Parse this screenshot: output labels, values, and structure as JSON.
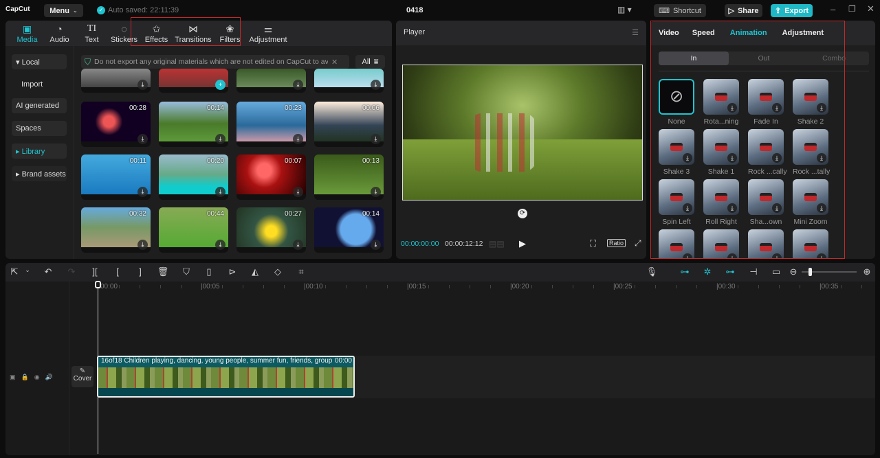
{
  "app": {
    "logo": "CapCut",
    "menu_label": "Menu",
    "autosave": "Auto saved: 22:11:39",
    "project_title": "0418",
    "shortcut_label": "Shortcut",
    "share_label": "Share",
    "export_label": "Export"
  },
  "colors": {
    "accent": "#1fc4d0",
    "highlight_box": "#c62828"
  },
  "media_tabs": [
    {
      "label": "Media",
      "icon": "media-icon"
    },
    {
      "label": "Audio",
      "icon": "audio-icon"
    },
    {
      "label": "Text",
      "icon": "text-icon"
    },
    {
      "label": "Stickers",
      "icon": "stickers-icon"
    },
    {
      "label": "Effects",
      "icon": "effects-icon"
    },
    {
      "label": "Transitions",
      "icon": "transitions-icon"
    },
    {
      "label": "Filters",
      "icon": "filters-icon"
    },
    {
      "label": "Adjustment",
      "icon": "adjustment-icon"
    }
  ],
  "sidebar": {
    "items": [
      {
        "label": "▾ Local"
      },
      {
        "label": "Import"
      },
      {
        "label": "AI generated"
      },
      {
        "label": "Spaces"
      },
      {
        "label": "▸ Library"
      },
      {
        "label": "▸ Brand assets"
      }
    ]
  },
  "notice": {
    "text": "Do not export any original materials which are not edited on CapCut to avoid",
    "filter_label": "All"
  },
  "library": {
    "durations": [
      "",
      "",
      "",
      "",
      "00:28",
      "00:14",
      "00:23",
      "00:06",
      "00:11",
      "00:20",
      "00:07",
      "00:13",
      "00:32",
      "00:44",
      "00:27",
      "00:14"
    ]
  },
  "player": {
    "title": "Player",
    "current_time": "00:00:00:00",
    "total_time": "00:00:12:12",
    "ratio_label": "Ratio"
  },
  "inspector": {
    "tabs": [
      "Video",
      "Speed",
      "Animation",
      "Adjustment"
    ],
    "active_tab": "Animation",
    "subtabs": [
      "In",
      "Out",
      "Combo"
    ],
    "animations": [
      "None",
      "Rota...ning",
      "Fade In",
      "Shake 2",
      "Shake 3",
      "Shake 1",
      "Rock ...cally",
      "Rock ...tally",
      "Spin Left",
      "Roll Right",
      "Sha...own",
      "Mini Zoom",
      "",
      "",
      "",
      ""
    ]
  },
  "timeline": {
    "ticks": [
      "00:00",
      "|00:05",
      "|00:10",
      "|00:15",
      "|00:20",
      "|00:25",
      "|00:30",
      "|00:35"
    ],
    "clip_title": "16of18 Children playing, dancing, young people, summer fun, friends, group",
    "clip_time": "00:00",
    "cover_label": "Cover"
  }
}
